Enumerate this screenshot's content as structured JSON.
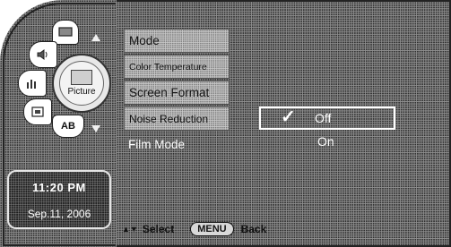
{
  "dial": {
    "center_label": "Picture",
    "ab_label": "AB"
  },
  "clock": {
    "time": "11:20 PM",
    "date": "Sep.11, 2006"
  },
  "menu": {
    "items": [
      {
        "label": "Mode"
      },
      {
        "label": "Color Temperature"
      },
      {
        "label": "Screen Format"
      },
      {
        "label": "Noise Reduction"
      },
      {
        "label": "Film Mode"
      }
    ],
    "selected_index": 4
  },
  "options": {
    "check_mark": "✓",
    "off_label": "Off",
    "on_label": "On",
    "selected": "Off"
  },
  "footer": {
    "nav_arrows": "▲▼",
    "select_label": "Select",
    "menu_key": "MENU",
    "back_label": "Back"
  },
  "icons": [
    "picture-icon",
    "speaker-icon",
    "equalizer-icon",
    "settings-icon",
    "up-arrow-icon",
    "down-arrow-icon"
  ]
}
